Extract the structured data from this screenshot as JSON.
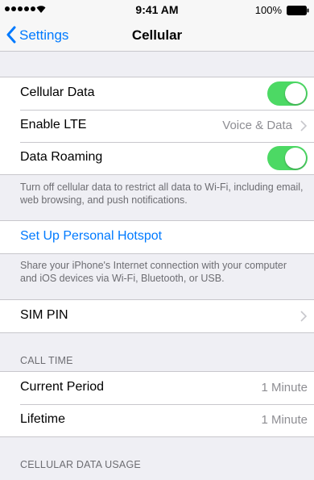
{
  "status": {
    "time": "9:41 AM",
    "battery": "100%"
  },
  "nav": {
    "back_label": "Settings",
    "title": "Cellular"
  },
  "cellular": {
    "data_label": "Cellular Data",
    "data_on": true,
    "lte_label": "Enable LTE",
    "lte_value": "Voice & Data",
    "roaming_label": "Data Roaming",
    "roaming_on": true,
    "footer": "Turn off cellular data to restrict all data to Wi-Fi, including email, web browsing, and push notifications."
  },
  "hotspot": {
    "label": "Set Up Personal Hotspot",
    "footer": "Share your iPhone's Internet connection with your computer and iOS devices via Wi-Fi, Bluetooth, or USB."
  },
  "sim": {
    "label": "SIM PIN"
  },
  "call_time": {
    "header": "CALL TIME",
    "current_label": "Current Period",
    "current_value": "1 Minute",
    "lifetime_label": "Lifetime",
    "lifetime_value": "1 Minute"
  },
  "usage": {
    "header": "CELLULAR DATA USAGE"
  },
  "colors": {
    "accent": "#007aff",
    "toggle_on": "#4cd964",
    "background": "#efeff4"
  }
}
